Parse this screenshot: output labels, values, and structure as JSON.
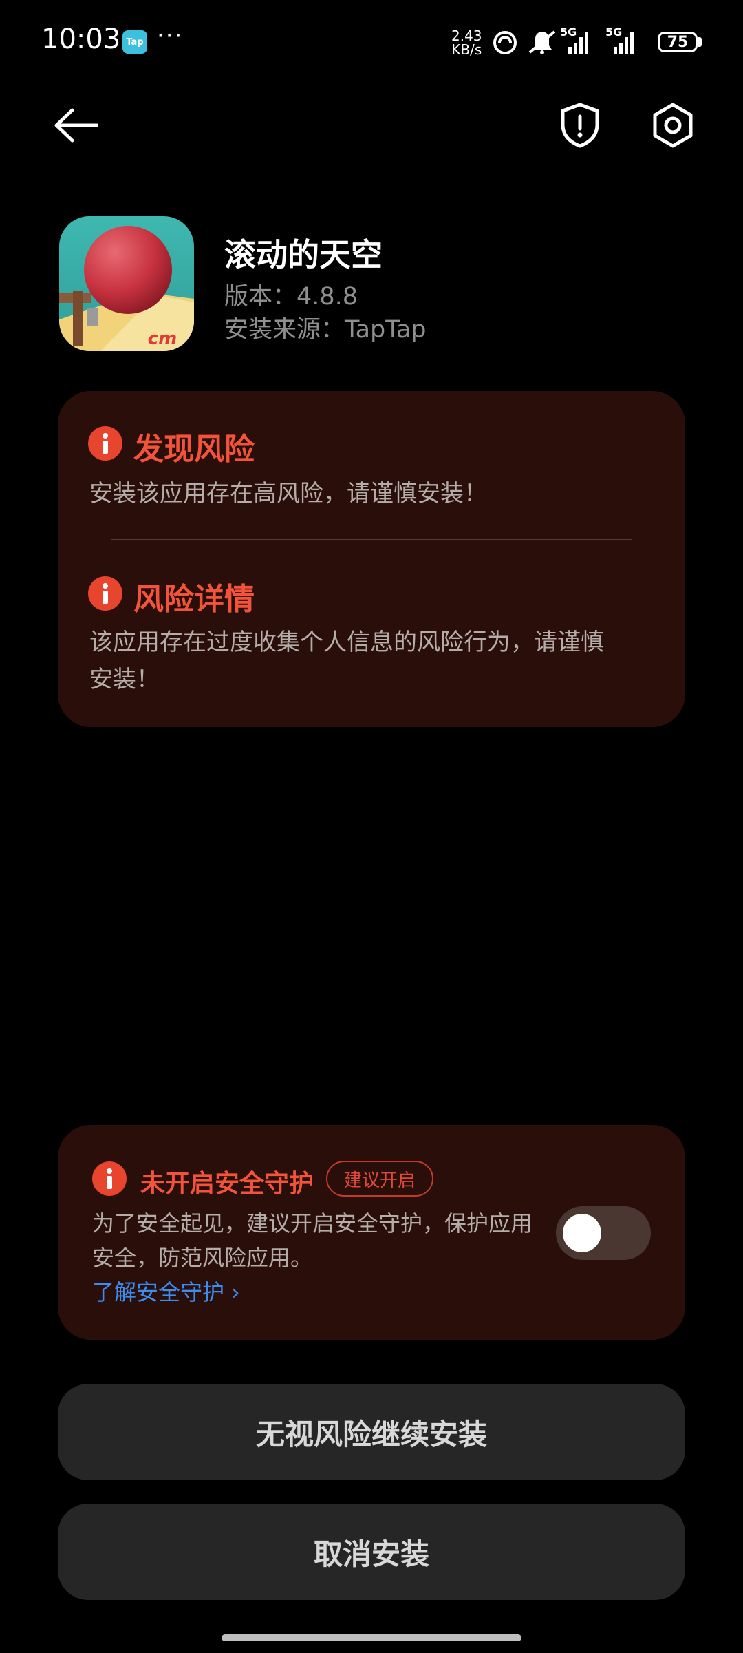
{
  "status_bar": {
    "time": "10:03",
    "app_badge": "Tap",
    "more": "···",
    "net_speed_value": "2.43",
    "net_speed_unit": "KB/s",
    "signal_1_label": "5G",
    "signal_2_label": "5G",
    "battery": "75"
  },
  "app": {
    "name": "滚动的天空",
    "version_label": "版本：",
    "version": "4.8.8",
    "source_label": "安装来源：",
    "source": "TapTap",
    "icon_brand": "cm"
  },
  "risk_card": {
    "found_title": "发现风险",
    "found_text": "安装该应用存在高风险，请谨慎安装！",
    "detail_title": "风险详情",
    "detail_text_line1": "该应用存在过度收集个人信息的风险行为，请谨慎",
    "detail_text_line2": "安装！"
  },
  "security_card": {
    "title": "未开启安全守护",
    "badge": "建议开启",
    "text_line1": "为了安全起见，建议开启安全守护，保护应用",
    "text_line2": "安全，防范风险应用。",
    "link": "了解安全守护 ›",
    "toggle_on": false
  },
  "buttons": {
    "continue": "无视风险继续安装",
    "cancel": "取消安装"
  },
  "colors": {
    "accent_red": "#f2533b",
    "card_bg": "#2a0e09",
    "link_blue": "#3d8cf0"
  }
}
